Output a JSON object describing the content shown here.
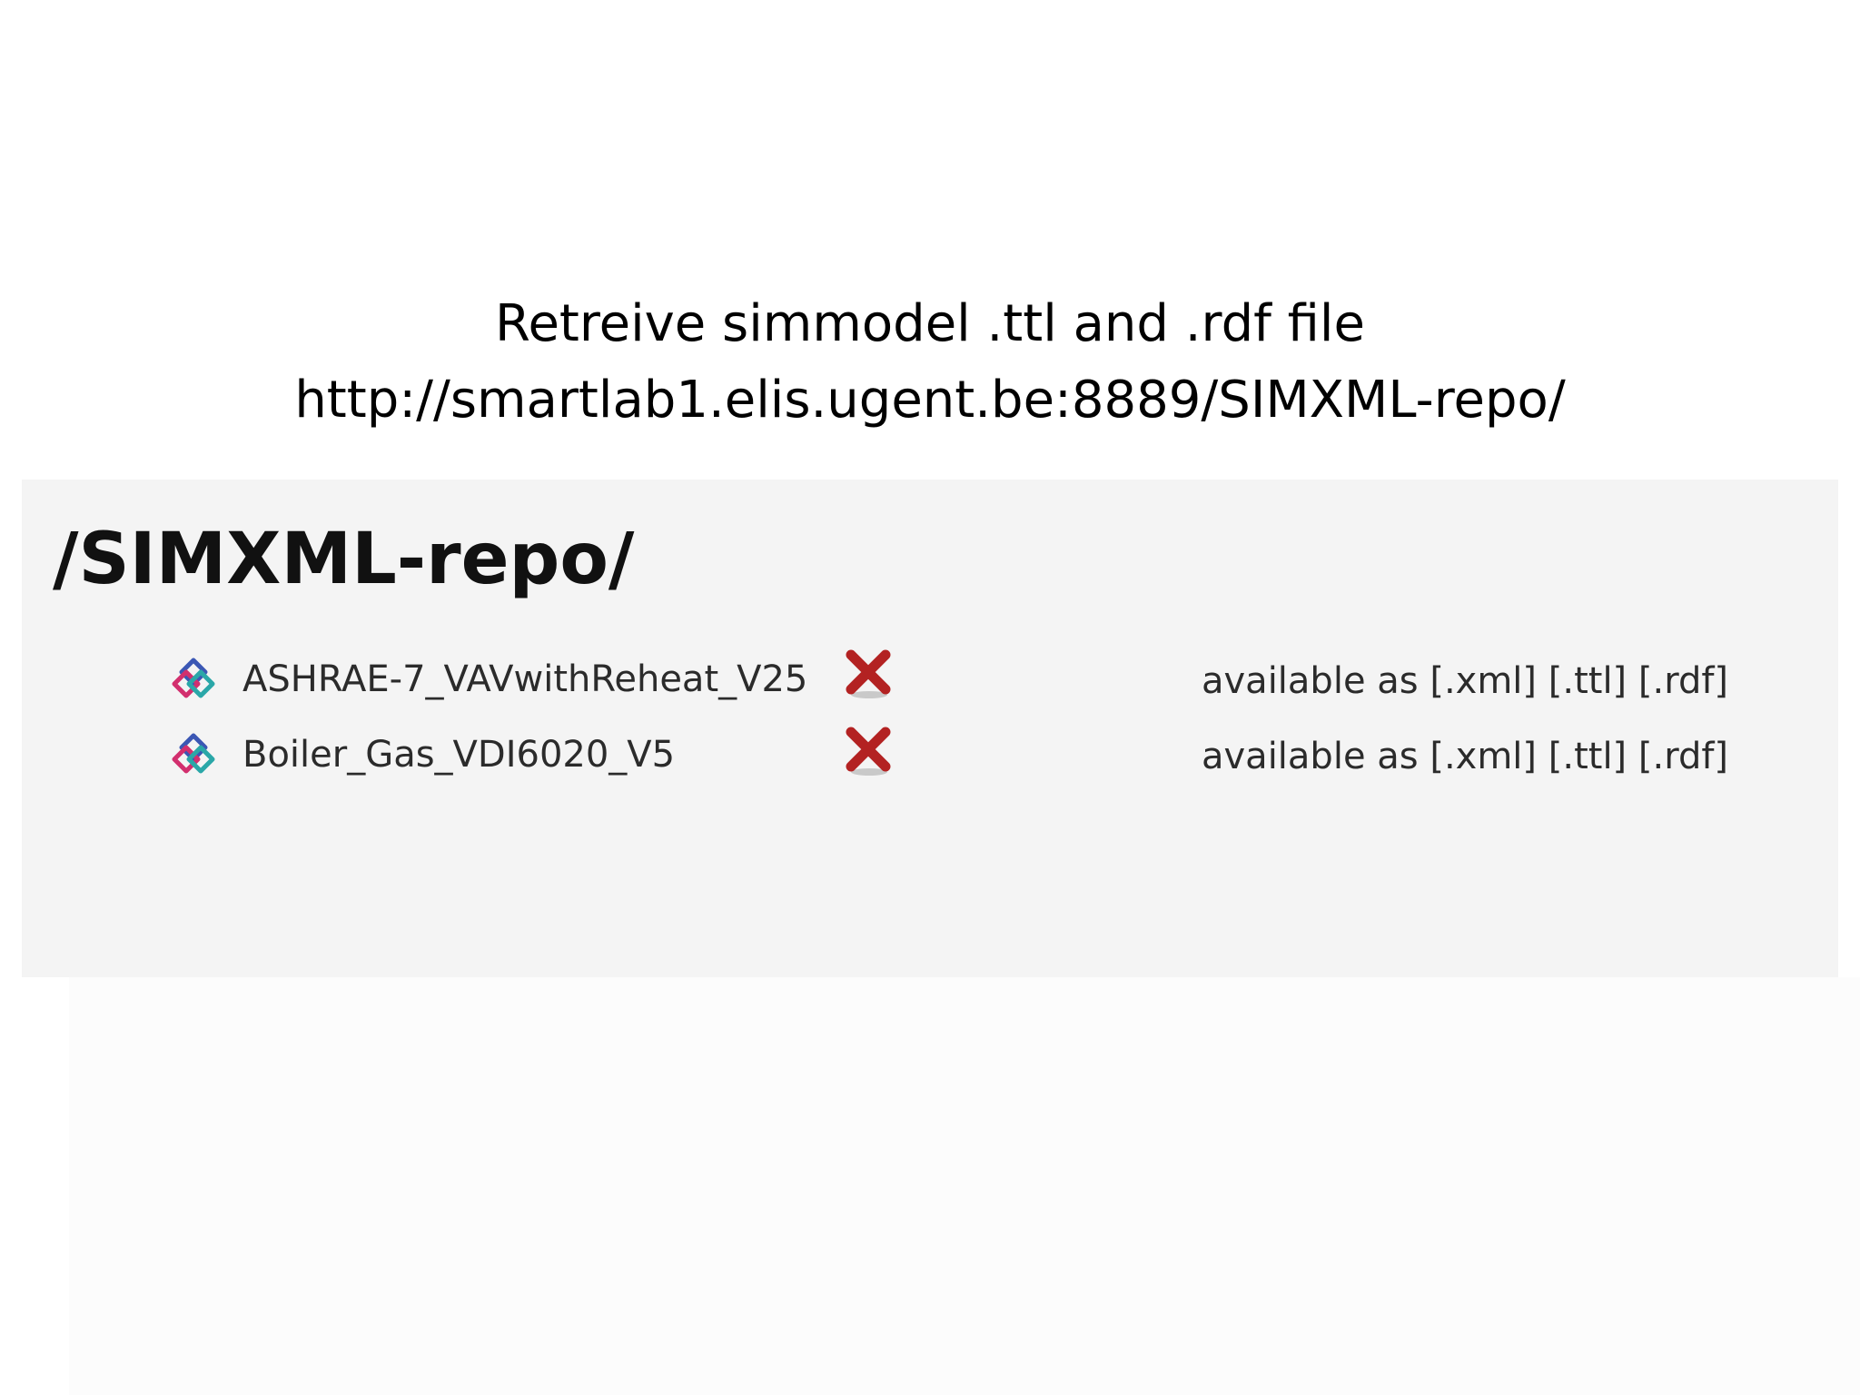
{
  "slide": {
    "heading_line1": "Retreive simmodel .ttl and .rdf file",
    "heading_line2": "http://smartlab1.elis.ugent.be:8889/SIMXML-repo/"
  },
  "repo": {
    "title": "/SIMXML-repo/",
    "files": [
      {
        "name": "ASHRAE-7_VAVwithReheat_V25",
        "available_prefix": "available as",
        "formats": [
          "[.xml]",
          "[.ttl]",
          "[.rdf]"
        ],
        "icon": "simmodel-file-icon",
        "delete_icon": "delete-x-icon"
      },
      {
        "name": "Boiler_Gas_VDI6020_V5",
        "available_prefix": "available as",
        "formats": [
          "[.xml]",
          "[.ttl]",
          "[.rdf]"
        ],
        "icon": "simmodel-file-icon",
        "delete_icon": "delete-x-icon"
      }
    ]
  },
  "colors": {
    "panel_background": "#f4f4f4",
    "delete_red": "#b32222",
    "icon_magenta": "#d22f6e",
    "icon_blue": "#3b57b4",
    "icon_teal": "#2aa7a8"
  }
}
